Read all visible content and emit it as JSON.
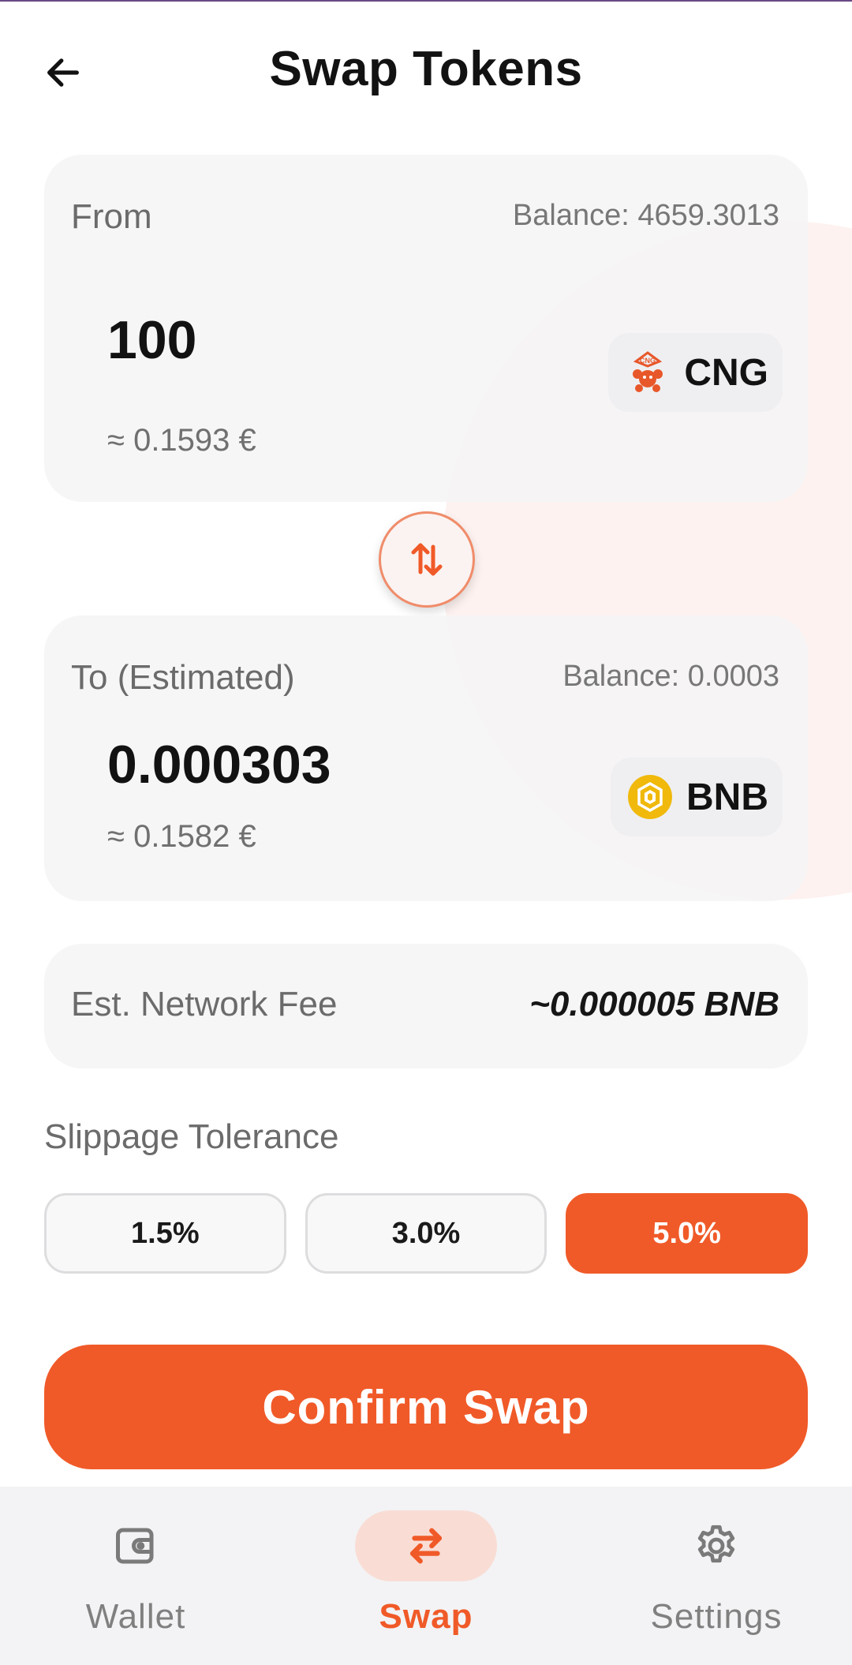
{
  "header": {
    "title": "Swap Tokens",
    "back_icon": "arrow-left-icon"
  },
  "from_card": {
    "label": "From",
    "balance": "Balance: 4659.3013",
    "amount": "100",
    "fiat_estimate": "≈ 0.1593 €",
    "token": {
      "symbol": "CNG",
      "icon": "cng-token-icon",
      "color": "#e8572a"
    }
  },
  "swap_direction": {
    "icon": "swap-vertical-icon",
    "color": "#f05a28"
  },
  "to_card": {
    "label": "To (Estimated)",
    "balance": "Balance: 0.0003",
    "amount": "0.000303",
    "fiat_estimate": "≈ 0.1582 €",
    "token": {
      "symbol": "BNB",
      "icon": "bnb-token-icon",
      "color": "#f0b90b"
    }
  },
  "fee": {
    "label": "Est. Network Fee",
    "value": "~0.000005 BNB"
  },
  "slippage": {
    "label": "Slippage Tolerance",
    "options": [
      "1.5%",
      "3.0%",
      "5.0%"
    ],
    "selected": "5.0%"
  },
  "confirm_button": {
    "label": "Confirm Swap"
  },
  "bottom_nav": {
    "items": [
      {
        "label": "Wallet",
        "icon": "wallet-icon",
        "active": false
      },
      {
        "label": "Swap",
        "icon": "swap-arrows-icon",
        "active": true
      },
      {
        "label": "Settings",
        "icon": "gear-icon",
        "active": false
      }
    ]
  },
  "colors": {
    "accent": "#f05a28",
    "card_background": "#f4f4f5",
    "nav_background": "#f3f3f5"
  }
}
